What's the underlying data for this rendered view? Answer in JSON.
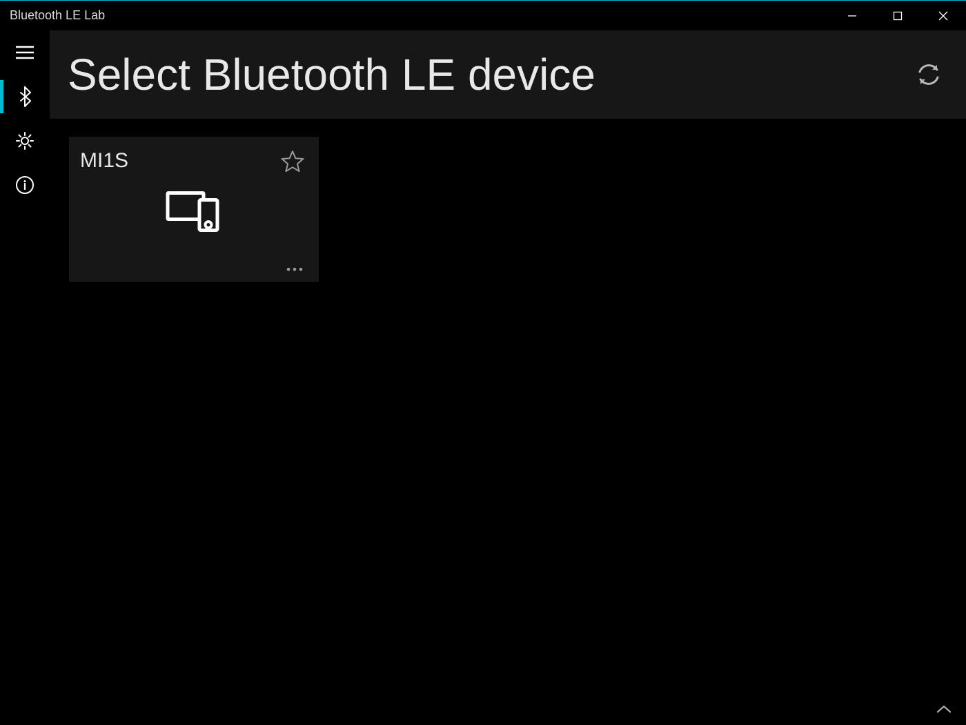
{
  "window": {
    "title": "Bluetooth LE Lab"
  },
  "sidebar": {
    "items": [
      {
        "name": "menu",
        "active": false
      },
      {
        "name": "bluetooth",
        "active": true
      },
      {
        "name": "settings",
        "active": false
      },
      {
        "name": "info",
        "active": false
      }
    ]
  },
  "header": {
    "title": "Select Bluetooth LE device"
  },
  "devices": [
    {
      "name": "MI1S"
    }
  ]
}
